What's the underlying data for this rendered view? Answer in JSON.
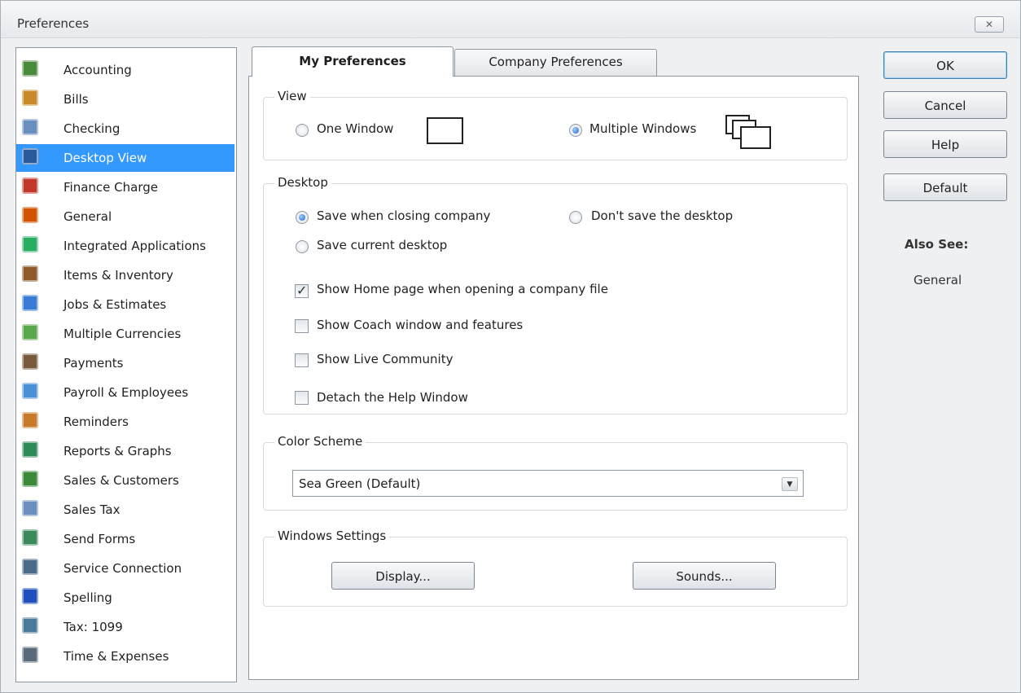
{
  "window": {
    "title": "Preferences",
    "close_glyph": "✕"
  },
  "sidebar": {
    "items": [
      {
        "label": "Accounting",
        "icon": "accounting-icon",
        "color": "#4a8a3c"
      },
      {
        "label": "Bills",
        "icon": "bills-icon",
        "color": "#c98a2a"
      },
      {
        "label": "Checking",
        "icon": "checking-icon",
        "color": "#6a8fbf"
      },
      {
        "label": "Desktop View",
        "icon": "desktop-view-icon",
        "color": "#2a5a9a",
        "selected": true
      },
      {
        "label": "Finance Charge",
        "icon": "finance-charge-icon",
        "color": "#c0392b"
      },
      {
        "label": "General",
        "icon": "general-icon",
        "color": "#d35400"
      },
      {
        "label": "Integrated Applications",
        "icon": "integrated-apps-icon",
        "color": "#27ae60"
      },
      {
        "label": "Items & Inventory",
        "icon": "items-inventory-icon",
        "color": "#8e5a2a"
      },
      {
        "label": "Jobs & Estimates",
        "icon": "jobs-estimates-icon",
        "color": "#3a7bd5"
      },
      {
        "label": "Multiple Currencies",
        "icon": "multiple-currencies-icon",
        "color": "#5aa64a"
      },
      {
        "label": "Payments",
        "icon": "payments-icon",
        "color": "#7a5a3a"
      },
      {
        "label": "Payroll & Employees",
        "icon": "payroll-employees-icon",
        "color": "#4a90d9"
      },
      {
        "label": "Reminders",
        "icon": "reminders-icon",
        "color": "#c87a2a"
      },
      {
        "label": "Reports & Graphs",
        "icon": "reports-graphs-icon",
        "color": "#2e8b57"
      },
      {
        "label": "Sales & Customers",
        "icon": "sales-customers-icon",
        "color": "#3a8a3a"
      },
      {
        "label": "Sales Tax",
        "icon": "sales-tax-icon",
        "color": "#6a8fbf"
      },
      {
        "label": "Send Forms",
        "icon": "send-forms-icon",
        "color": "#3a8a5a"
      },
      {
        "label": "Service Connection",
        "icon": "service-connection-icon",
        "color": "#4a6a8a"
      },
      {
        "label": "Spelling",
        "icon": "spelling-icon",
        "color": "#1f4fbf"
      },
      {
        "label": "Tax: 1099",
        "icon": "tax-1099-icon",
        "color": "#4a7a9a"
      },
      {
        "label": "Time & Expenses",
        "icon": "time-expenses-icon",
        "color": "#5a6a7a"
      }
    ]
  },
  "tabs": {
    "active": "My Preferences",
    "inactive": "Company Preferences"
  },
  "view": {
    "title": "View",
    "one_window": "One Window",
    "multiple_windows": "Multiple Windows",
    "selected": "multiple_windows"
  },
  "desktop": {
    "title": "Desktop",
    "save_closing": "Save when closing company",
    "dont_save": "Don't save the desktop",
    "save_current": "Save current desktop",
    "show_home": "Show Home page when opening a company file",
    "show_coach": "Show Coach window and features",
    "show_live": "Show Live Community",
    "detach_help": "Detach the Help Window"
  },
  "color_scheme": {
    "title": "Color Scheme",
    "value": "Sea Green (Default)"
  },
  "windows_settings": {
    "title": "Windows Settings",
    "display": "Display...",
    "sounds": "Sounds..."
  },
  "buttons": {
    "ok": "OK",
    "cancel": "Cancel",
    "help": "Help",
    "default": "Default"
  },
  "also_see": {
    "title": "Also See:",
    "link": "General"
  },
  "colors": {
    "selection": "#3399ff",
    "dialog_bg": "#eef0f2"
  }
}
